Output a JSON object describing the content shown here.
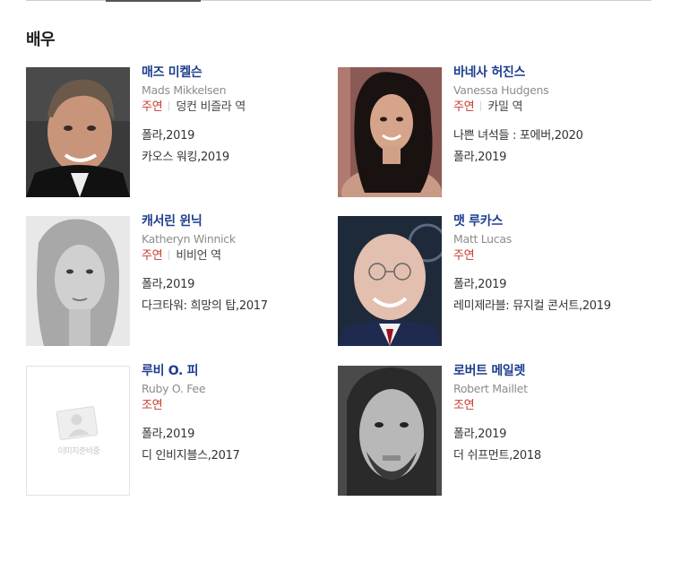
{
  "section": {
    "title": "배우"
  },
  "cast": [
    {
      "name_ko": "매즈 미켈슨",
      "name_en": "Mads Mikkelsen",
      "role_type": "주연",
      "character": "덩컨 비즐라 역",
      "works": [
        "폴라,2019",
        "카오스 워킹,2019"
      ]
    },
    {
      "name_ko": "바네사 허진스",
      "name_en": "Vanessa Hudgens",
      "role_type": "주연",
      "character": "카밀 역",
      "works": [
        "나쁜 녀석들 : 포에버,2020",
        "폴라,2019"
      ]
    },
    {
      "name_ko": "캐서린 윈닉",
      "name_en": "Katheryn Winnick",
      "role_type": "주연",
      "character": "비비언 역",
      "works": [
        "폴라,2019",
        "다크타워: 희망의 탑,2017"
      ]
    },
    {
      "name_ko": "맷 루카스",
      "name_en": "Matt Lucas",
      "role_type": "주연",
      "character": "",
      "works": [
        "폴라,2019",
        "레미제라블: 뮤지컬 콘서트,2019"
      ]
    },
    {
      "name_ko": "루비 O. 피",
      "name_en": "Ruby O. Fee",
      "role_type": "조연",
      "character": "",
      "works": [
        "폴라,2019",
        "디 인비지블스,2017"
      ],
      "placeholder_text": "이미지준비중"
    },
    {
      "name_ko": "로버트 메일렛",
      "name_en": "Robert Maillet",
      "role_type": "조연",
      "character": "",
      "works": [
        "폴라,2019",
        "더 쉬프먼트,2018"
      ]
    }
  ]
}
